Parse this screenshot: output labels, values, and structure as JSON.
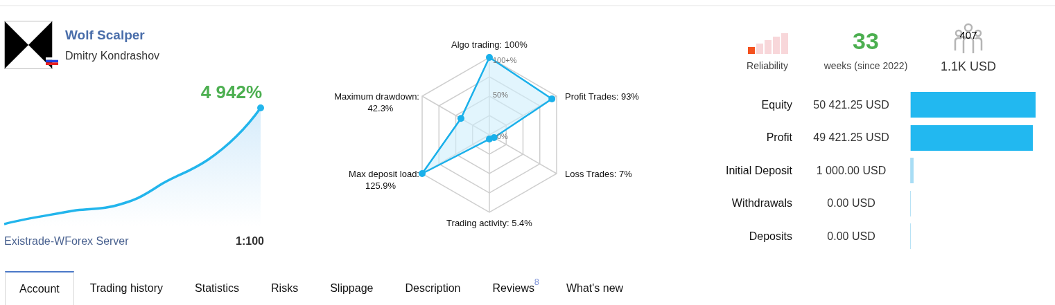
{
  "signal": {
    "name": "Wolf Scalper",
    "author": "Dmitry Kondrashov",
    "growth": "4 942%",
    "server": "Existrade-WForex Server",
    "leverage": "1:100"
  },
  "radar": {
    "ring_labels": [
      "100+%",
      "50%",
      "0%"
    ],
    "axes": [
      {
        "label": "Algo trading: 100%"
      },
      {
        "label": "Maximum drawdown:",
        "value": "42.3%"
      },
      {
        "label": "Profit Trades: 93%"
      },
      {
        "label": "Max deposit load:",
        "value": "125.9%"
      },
      {
        "label": "Loss Trades: 7%"
      },
      {
        "label": "Trading activity: 5.4%"
      }
    ]
  },
  "stats": {
    "reliability_label": "Reliability",
    "weeks": "33",
    "weeks_label": "weeks (since 2022)",
    "subscribers": "407",
    "subscribers_funds": "1.1K USD"
  },
  "account": [
    {
      "label": "Equity",
      "value": "50 421.25 USD",
      "level": 1,
      "color": "#22b8f0"
    },
    {
      "label": "Profit",
      "value": "49 421.25 USD",
      "level": 0.98,
      "color": "#22b8f0"
    },
    {
      "label": "Initial Deposit",
      "value": "1 000.00 USD",
      "level": 0.02,
      "color": "#a8ddf5"
    },
    {
      "label": "Withdrawals",
      "value": "0.00 USD"
    },
    {
      "label": "Deposits",
      "value": "0.00 USD"
    }
  ],
  "tabs": [
    {
      "label": "Account",
      "selected": true
    },
    {
      "label": "Trading history",
      "selected": false
    },
    {
      "label": "Statistics",
      "selected": false
    },
    {
      "label": "Risks",
      "selected": false
    },
    {
      "label": "Slippage",
      "selected": false
    },
    {
      "label": "Description",
      "selected": false
    },
    {
      "label": "Reviews",
      "selected": false,
      "badge": "8"
    },
    {
      "label": "What's new",
      "selected": false
    }
  ]
}
